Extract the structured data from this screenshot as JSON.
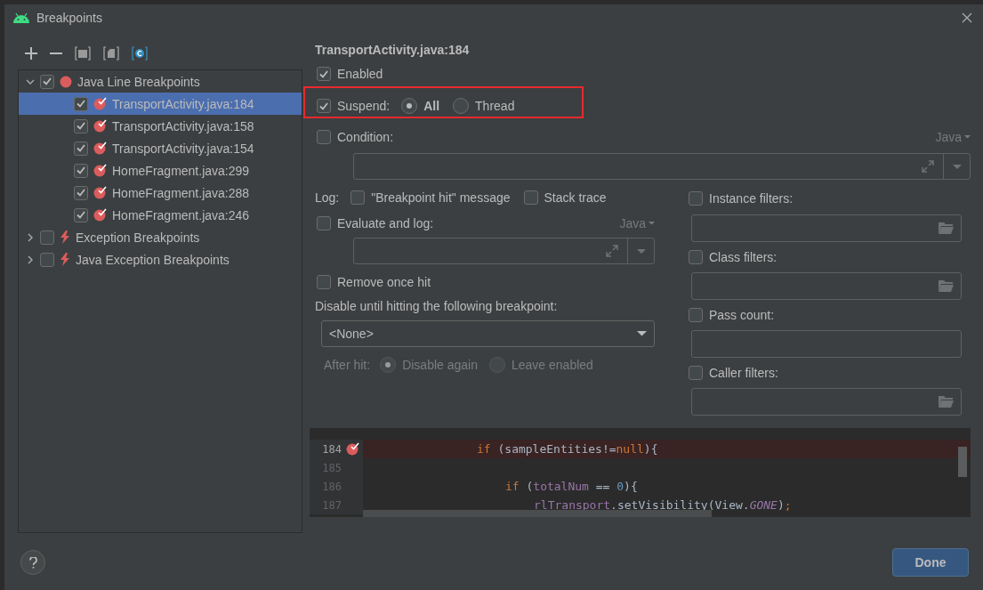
{
  "window": {
    "title": "Breakpoints"
  },
  "tree": [
    {
      "label": "Java Line Breakpoints",
      "kind": "line-group",
      "expanded": true,
      "checked": true,
      "selected": false,
      "children": [
        {
          "label": "TransportActivity.java:184",
          "kind": "line",
          "checked": true,
          "selected": true
        },
        {
          "label": "TransportActivity.java:158",
          "kind": "line",
          "checked": true,
          "selected": false
        },
        {
          "label": "TransportActivity.java:154",
          "kind": "line",
          "checked": true,
          "selected": false
        },
        {
          "label": "HomeFragment.java:299",
          "kind": "line",
          "checked": true,
          "selected": false
        },
        {
          "label": "HomeFragment.java:288",
          "kind": "line",
          "checked": true,
          "selected": false
        },
        {
          "label": "HomeFragment.java:246",
          "kind": "line",
          "checked": true,
          "selected": false
        }
      ]
    },
    {
      "label": "Exception Breakpoints",
      "kind": "exception-group",
      "expanded": false,
      "checked": false,
      "selected": false
    },
    {
      "label": "Java Exception Breakpoints",
      "kind": "exception-group",
      "expanded": false,
      "checked": false,
      "selected": false
    }
  ],
  "details": {
    "title": "TransportActivity.java:184",
    "enabled": {
      "label": "Enabled",
      "checked": true
    },
    "suspend": {
      "label": "Suspend:",
      "checked": true,
      "highlighted": true,
      "options": [
        {
          "label": "All",
          "selected": true
        },
        {
          "label": "Thread",
          "selected": false
        }
      ]
    },
    "condition": {
      "label": "Condition:",
      "checked": false,
      "language": "Java"
    },
    "log": {
      "label": "Log:",
      "options": [
        {
          "label": "\"Breakpoint hit\" message",
          "checked": false
        },
        {
          "label": "Stack trace",
          "checked": false
        }
      ]
    },
    "evaluate": {
      "label": "Evaluate and log:",
      "checked": false,
      "language": "Java"
    },
    "remove_once_hit": {
      "label": "Remove once hit",
      "checked": false
    },
    "disable_until": {
      "label": "Disable until hitting the following breakpoint:",
      "value": "<None>"
    },
    "after_hit": {
      "label": "After hit:",
      "disabled": true,
      "options": [
        {
          "label": "Disable again",
          "selected": true
        },
        {
          "label": "Leave enabled",
          "selected": false
        }
      ]
    },
    "filters": [
      {
        "label": "Instance filters:",
        "checked": false,
        "browse": true
      },
      {
        "label": "Class filters:",
        "checked": false,
        "browse": true
      },
      {
        "label": "Pass count:",
        "checked": false,
        "browse": false
      },
      {
        "label": "Caller filters:",
        "checked": false,
        "browse": true
      }
    ]
  },
  "code": {
    "lines": [
      {
        "number": "184",
        "breakpoint": true,
        "tokens": [
          {
            "kind": "keyword",
            "text": "if"
          },
          {
            "kind": "plain",
            "text": " (sampleEntities!="
          },
          {
            "kind": "keyword",
            "text": "null"
          },
          {
            "kind": "plain",
            "text": "){"
          }
        ]
      },
      {
        "number": "185",
        "breakpoint": false
      },
      {
        "number": "186",
        "breakpoint": false,
        "tokens": [
          {
            "kind": "keyword",
            "text": "if"
          },
          {
            "kind": "plain",
            "text": " ("
          },
          {
            "kind": "field",
            "text": "totalNum"
          },
          {
            "kind": "plain",
            "text": " == "
          },
          {
            "kind": "number",
            "text": "0"
          },
          {
            "kind": "plain",
            "text": "){"
          }
        ]
      },
      {
        "number": "187",
        "breakpoint": false,
        "tokens": [
          {
            "kind": "field",
            "text": "rlTransport"
          },
          {
            "kind": "plain",
            "text": ".setVisibility(View."
          },
          {
            "kind": "constant",
            "text": "GONE"
          },
          {
            "kind": "plain",
            "text": ")"
          },
          {
            "kind": "keyword",
            "text": ";"
          }
        ]
      }
    ]
  },
  "footer": {
    "done": "Done"
  }
}
